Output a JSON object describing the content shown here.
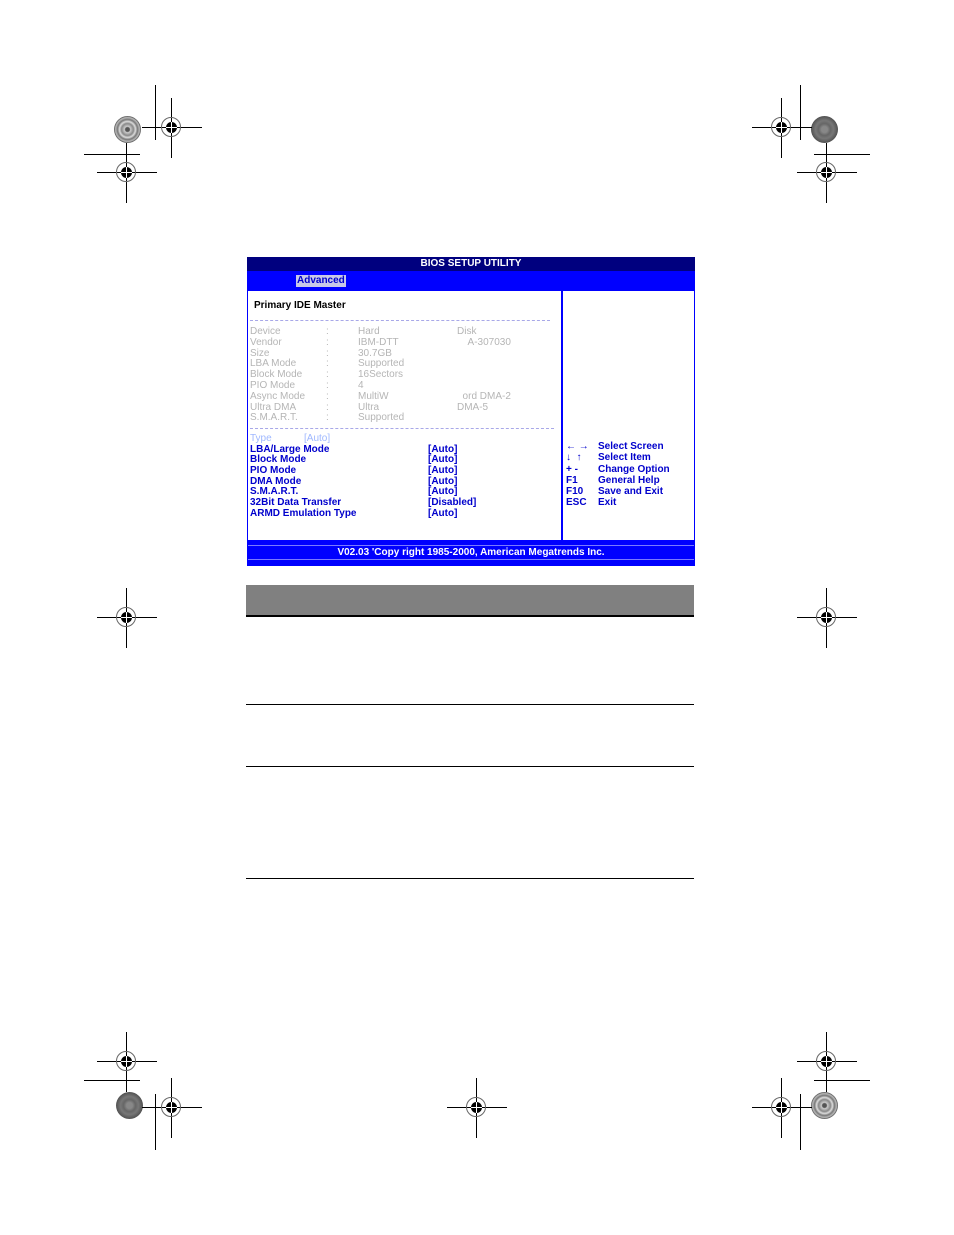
{
  "bios": {
    "title": "BIOS SETUP UTILITY",
    "active_tab": "Advanced",
    "section_title": "Primary IDE Master",
    "device_info": [
      {
        "label": "Device",
        "sep": ":",
        "value": "Hard",
        "value2": "Disk"
      },
      {
        "label": "Vendor",
        "sep": ":",
        "value": "IBM-DTT",
        "value2": "    A-307030"
      },
      {
        "label": "Size",
        "sep": ":",
        "value": "30.7GB",
        "value2": ""
      },
      {
        "label": "LBA Mode",
        "sep": ":",
        "value": "Supported",
        "value2": ""
      },
      {
        "label": "Block Mode",
        "sep": ":",
        "value": "16Sectors",
        "value2": ""
      },
      {
        "label": "PIO Mode",
        "sep": ":",
        "value": "4",
        "value2": ""
      },
      {
        "label": "Async Mode",
        "sep": ":",
        "value": "MultiW",
        "value2": "  ord DMA-2"
      },
      {
        "label": "Ultra DMA",
        "sep": ":",
        "value": "Ultra",
        "value2": "DMA-5"
      },
      {
        "label": "S.M.A.R.T.",
        "sep": ":",
        "value": "Supported",
        "value2": ""
      }
    ],
    "type_option": {
      "label": "Type",
      "value": "[Auto]"
    },
    "options": [
      {
        "label": "LBA/Large Mode",
        "value": "[Auto]"
      },
      {
        "label": "Block Mode",
        "value": "[Auto]"
      },
      {
        "label": "PIO Mode",
        "value": "[Auto]"
      },
      {
        "label": "DMA Mode",
        "value": "[Auto]"
      },
      {
        "label": "S.M.A.R.T.",
        "value": "[Auto]"
      },
      {
        "label": "32Bit Data Transfer",
        "value": "[Disabled]"
      },
      {
        "label": "ARMD Emulation Type",
        "value": "[Auto]"
      }
    ],
    "help_keys": [
      {
        "key": "← →",
        "desc": "Select Screen"
      },
      {
        "key": "↓  ↑",
        "desc": "Select Item"
      },
      {
        "key": "+ -",
        "desc": "Change Option"
      },
      {
        "key": "F1",
        "desc": "General Help"
      },
      {
        "key": "F10",
        "desc": "Save and Exit"
      },
      {
        "key": "ESC",
        "desc": "Exit"
      }
    ],
    "footer": "V02.03 'Copy  right 1985-2000, American Megatrends Inc.",
    "colors": {
      "title_bg": "#00007f",
      "screen_blue": "#0000ff",
      "option_text": "#0000cc",
      "disabled_text": "#b5b5b5"
    }
  },
  "table": {
    "header_color": "#808080",
    "rows": 3
  }
}
